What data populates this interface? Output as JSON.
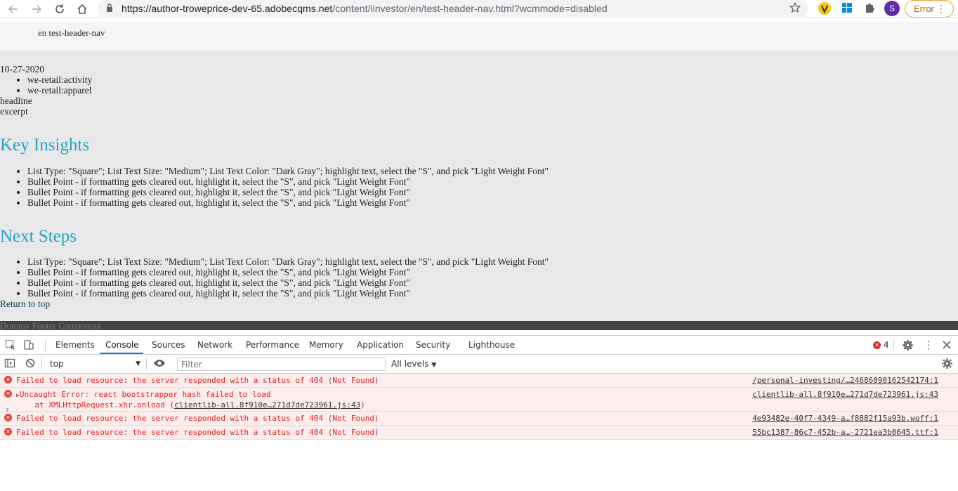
{
  "browser": {
    "url_host": "https://author-troweprice-dev-65.adobecqms.net",
    "url_path": "/content/iinvestor/en/test-header-nav.html?wcmmode=disabled",
    "profile_initial": "S",
    "error_label": "Error"
  },
  "page": {
    "header": {
      "lang": "en",
      "title": "test-header-nav"
    },
    "date": "10-27-2020",
    "tags": [
      "we-retail:activity",
      "we-retail:apparel"
    ],
    "headline": "headline",
    "excerpt": "excerpt",
    "key_insights": {
      "heading": "Key Insights",
      "items": [
        "List Type: \"Square\"; List Text Size: \"Medium\"; List Text Color: \"Dark Gray\"; highlight text, select the \"S\", and pick \"Light Weight Font\"",
        "Bullet Point - if formatting gets cleared out, highlight it, select the \"S\", and pick \"Light Weight Font\"",
        "Bullet Point - if formatting gets cleared out, highlight it, select the \"S\", and pick \"Light Weight Font\"",
        "Bullet Point - if formatting gets cleared out, highlight it, select the \"S\", and pick \"Light Weight Font\""
      ]
    },
    "next_steps": {
      "heading": "Next Steps",
      "items": [
        "List Type: \"Square\"; List Text Size: \"Medium\"; List Text Color: \"Dark Gray\"; highlight text, select the \"S\", and pick \"Light Weight Font\"",
        "Bullet Point - if formatting gets cleared out, highlight it, select the \"S\", and pick \"Light Weight Font\"",
        "Bullet Point - if formatting gets cleared out, highlight it, select the \"S\", and pick \"Light Weight Font\"",
        "Bullet Point - if formatting gets cleared out, highlight it, select the \"S\", and pick \"Light Weight Font\""
      ]
    },
    "return_to_top": "Return to top",
    "footer_text": "Dummy Footer Component"
  },
  "devtools": {
    "tabs": [
      "Elements",
      "Console",
      "Sources",
      "Network",
      "Performance",
      "Memory",
      "Application",
      "Security",
      "Lighthouse"
    ],
    "active_tab": "Console",
    "error_count": "4",
    "context": "top",
    "filter_placeholder": "Filter",
    "levels": "All levels",
    "messages": [
      {
        "text": "Failed to load resource: the server responded with a status of 404 (Not Found)",
        "source": "/personal-investing/…24686090162542174:1"
      },
      {
        "text": "Uncaught Error: react bootstrapper hash failed to load",
        "stack_prefix": "    at XMLHttpRequest.xhr.onload (",
        "stack_link": "clientlib-all.8f910e…271d7de723961.js:43",
        "stack_suffix": ")",
        "source": "clientlib-all.8f910e…271d7de723961.js:43"
      },
      {
        "text": "Failed to load resource: the server responded with a status of 404 (Not Found)",
        "source": "4e93482e-40f7-4349-a…f8882f15a93b.woff:1"
      },
      {
        "text": "Failed to load resource: the server responded with a status of 404 (Not Found)",
        "source": "55bc1387-86c7-452b-a…-2721ea3b0645.ttf:1"
      }
    ],
    "prompt_symbol": "›"
  },
  "colors": {
    "heading": "#1fa5c7",
    "error_text": "#e02020",
    "error_bg": "#fdeeee",
    "accent": "#1a73e8"
  },
  "icons": [
    "back-arrow-icon",
    "forward-arrow-icon",
    "reload-icon",
    "home-icon",
    "lock-icon",
    "star-icon",
    "extension-icon",
    "puzzle-icon",
    "inspect-icon",
    "device-icon",
    "gear-icon",
    "more-vert-icon",
    "close-icon",
    "sidebar-icon",
    "clear-icon",
    "eye-icon"
  ]
}
